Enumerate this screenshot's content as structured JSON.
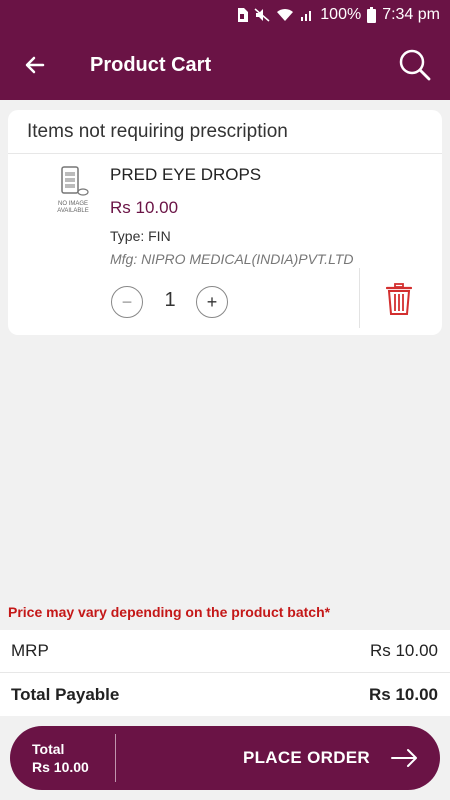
{
  "status_bar": {
    "battery": "100%",
    "time": "7:34 pm",
    "icons": [
      "sim-icon",
      "mute-icon",
      "wifi-icon",
      "signal-icon",
      "battery-icon"
    ]
  },
  "header": {
    "title": "Product Cart",
    "back_icon": "back-arrow-icon",
    "search_icon": "search-icon"
  },
  "cart": {
    "section_title": "Items not requiring prescription",
    "items": [
      {
        "image_text": "NO IMAGE AVAILABLE",
        "name": "PRED EYE DROPS",
        "price": "Rs 10.00",
        "type": "Type: FIN",
        "mfg": "Mfg: NIPRO MEDICAL(INDIA)PVT.LTD",
        "quantity": "1",
        "minus_label": "−",
        "plus_label": "+"
      }
    ]
  },
  "notice": "Price may vary depending on the product batch*",
  "summary": {
    "mrp_label": "MRP",
    "mrp_value": "Rs 10.00",
    "total_label": "Total Payable",
    "total_value": "Rs 10.00"
  },
  "order_bar": {
    "total_label": "Total",
    "total_value": "Rs 10.00",
    "button_label": "PLACE ORDER"
  },
  "colors": {
    "brand": "#6a1345",
    "notice": "#c41818",
    "delete": "#d32f2f"
  }
}
